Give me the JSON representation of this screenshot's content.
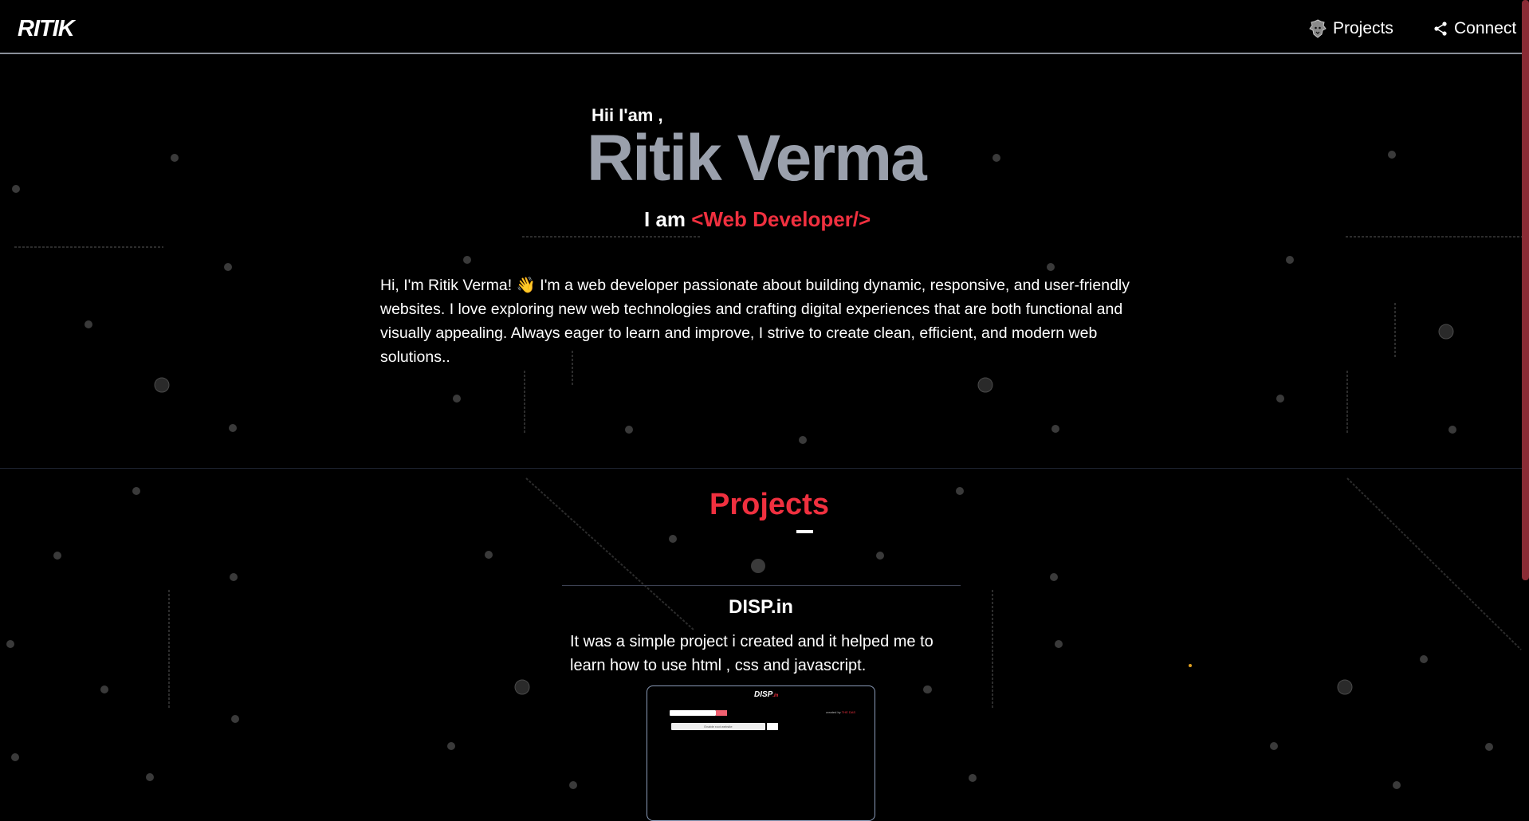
{
  "navbar": {
    "logo": "RITIK",
    "projects_label": "Projects",
    "connect_label": "Connect",
    "projects_icon": "lion-head-icon",
    "connect_icon": "share-nodes-icon"
  },
  "hero": {
    "greeting": "Hii I'am ,",
    "name": "Ritik Verma",
    "role_prefix": "I am",
    "role_highlight": "<Web Developer/>",
    "bio": "Hi, I'm Ritik Verma! 👋 I'm a web developer passionate about building dynamic, responsive, and user-friendly websites. I love exploring new web technologies and crafting digital experiences that are both functional and visually appealing. Always eager to learn and improve, I strive to create clean, efficient, and modern web solutions.."
  },
  "projects": {
    "title": "Projects",
    "items": [
      {
        "name": "DISP.in",
        "description": "It was a simple project i created and it helped me to learn how to use html , css and javascript.",
        "preview": {
          "logo": "DISP",
          "logo_suffix": ".in",
          "right_text": "created by",
          "right_highlight": "THE DAS",
          "bar_text": "Enable root website"
        }
      }
    ]
  },
  "colors": {
    "accent": "#f0303f",
    "name_gray": "#9aa0ac",
    "background": "#000000"
  }
}
